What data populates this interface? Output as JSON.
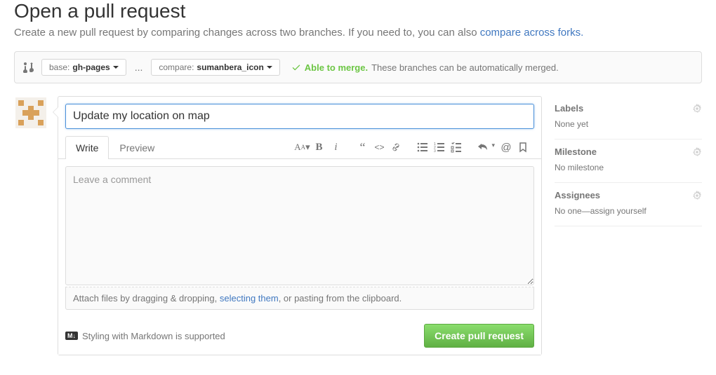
{
  "header": {
    "title": "Open a pull request",
    "subtitle_prefix": "Create a new pull request by comparing changes across two branches. If you need to, you can also ",
    "subtitle_link": "compare across forks."
  },
  "range": {
    "base_label": "base: ",
    "base_value": "gh-pages",
    "dots": "...",
    "compare_label": "compare: ",
    "compare_value": "sumanbera_icon",
    "merge_ok": "Able to merge.",
    "merge_note": " These branches can be automatically merged."
  },
  "form": {
    "title_value": "Update my location on map",
    "tabs": {
      "write": "Write",
      "preview": "Preview"
    },
    "comment_placeholder": "Leave a comment",
    "drag_hint_prefix": "Attach files by dragging & dropping, ",
    "drag_hint_link": "selecting them",
    "drag_hint_suffix": ", or pasting from the clipboard.",
    "markdown_badge": "M↓",
    "markdown_hint": "Styling with Markdown is supported",
    "submit_label": "Create pull request"
  },
  "sidebar": {
    "labels": {
      "title": "Labels",
      "value": "None yet"
    },
    "milestone": {
      "title": "Milestone",
      "value": "No milestone"
    },
    "assignees": {
      "title": "Assignees",
      "prefix": "No one—",
      "link": "assign yourself"
    }
  }
}
